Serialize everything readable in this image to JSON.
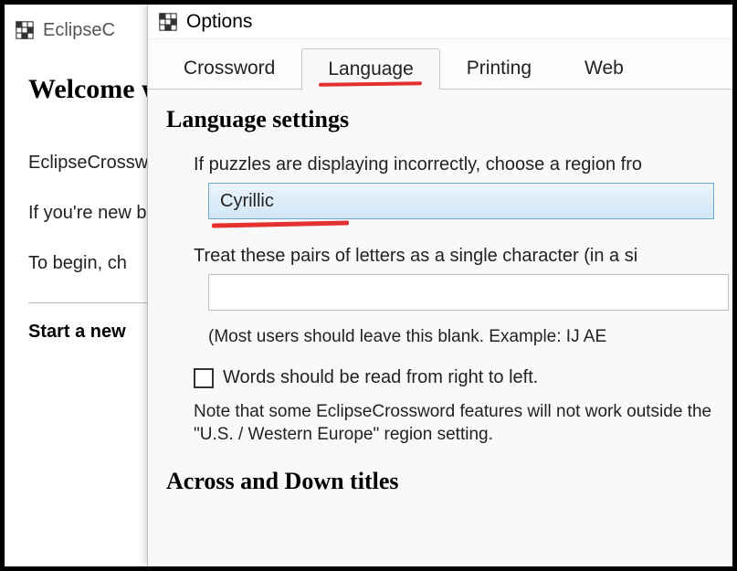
{
  "background": {
    "app_title": "EclipseC",
    "welcome_heading": "Welcome wizard!",
    "para1": "EclipseCrossw will guide yo",
    "para2": "If you're new bottom of thi while you're",
    "para3": "To begin, ch",
    "start_label": "Start a new"
  },
  "options": {
    "title": "Options",
    "tabs": [
      "Crossword",
      "Language",
      "Printing",
      "Web"
    ],
    "active_tab": 1,
    "language": {
      "heading": "Language settings",
      "region_label": "If puzzles are displaying incorrectly, choose a region fro",
      "region_value": "Cyrillic",
      "pairs_label": "Treat these pairs of letters as a single character (in a si",
      "pairs_value": "",
      "pairs_hint": "(Most users should leave this blank.  Example: IJ AE",
      "rtl_label": "Words should be read from right to left.",
      "rtl_checked": false,
      "note": "Note that some EclipseCrossword features will not work outside the \"U.S. / Western Europe\" region setting.",
      "across_heading": "Across and Down titles"
    }
  }
}
